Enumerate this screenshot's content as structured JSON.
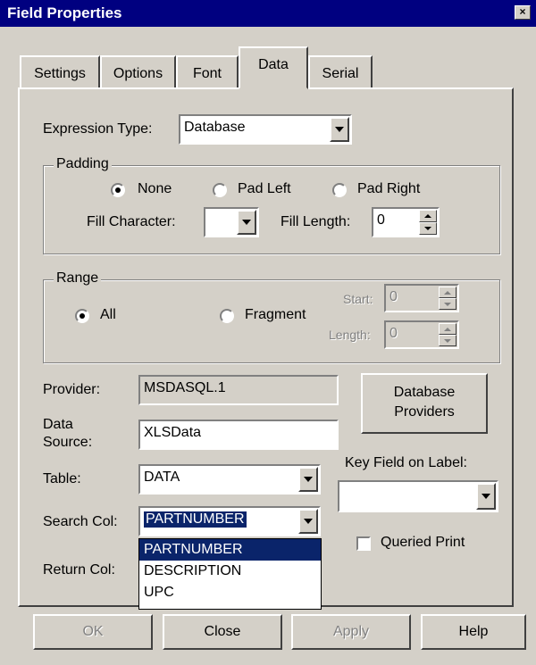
{
  "window": {
    "title": "Field Properties",
    "close_glyph": "×"
  },
  "tabs": [
    {
      "label": "Settings",
      "active": false
    },
    {
      "label": "Options",
      "active": false
    },
    {
      "label": "Font",
      "active": false
    },
    {
      "label": "Data",
      "active": true
    },
    {
      "label": "Serial",
      "active": false
    }
  ],
  "expression_type": {
    "label": "Expression Type:",
    "value": "Database"
  },
  "padding": {
    "legend": "Padding",
    "options": [
      {
        "label": "None",
        "checked": true
      },
      {
        "label": "Pad Left",
        "checked": false
      },
      {
        "label": "Pad Right",
        "checked": false
      }
    ],
    "fill_character_label": "Fill Character:",
    "fill_character_value": "",
    "fill_length_label": "Fill Length:",
    "fill_length_value": "0"
  },
  "range": {
    "legend": "Range",
    "options": [
      {
        "label": "All",
        "checked": true
      },
      {
        "label": "Fragment",
        "checked": false
      }
    ],
    "start_label": "Start:",
    "start_value": "0",
    "length_label": "Length:",
    "length_value": "0"
  },
  "provider": {
    "label": "Provider:",
    "value": "MSDASQL.1"
  },
  "data_source": {
    "label_line1": "Data",
    "label_line2": "Source:",
    "value": "XLSData"
  },
  "table": {
    "label": "Table:",
    "value": "DATA"
  },
  "search_col": {
    "label": "Search Col:",
    "value": "PARTNUMBER"
  },
  "return_col": {
    "label": "Return Col:"
  },
  "database_providers_button": {
    "line1": "Database",
    "line2": "Providers"
  },
  "key_field": {
    "label": "Key Field on Label:",
    "value": ""
  },
  "queried_print": {
    "label": "Queried Print",
    "checked": false
  },
  "dropdown_options": [
    "PARTNUMBER",
    "DESCRIPTION",
    "UPC"
  ],
  "buttons": {
    "ok": "OK",
    "close": "Close",
    "apply": "Apply",
    "help": "Help"
  },
  "colors": {
    "face": "#d4d0c8",
    "title_bar": "#000080",
    "selection": "#0a246a"
  }
}
